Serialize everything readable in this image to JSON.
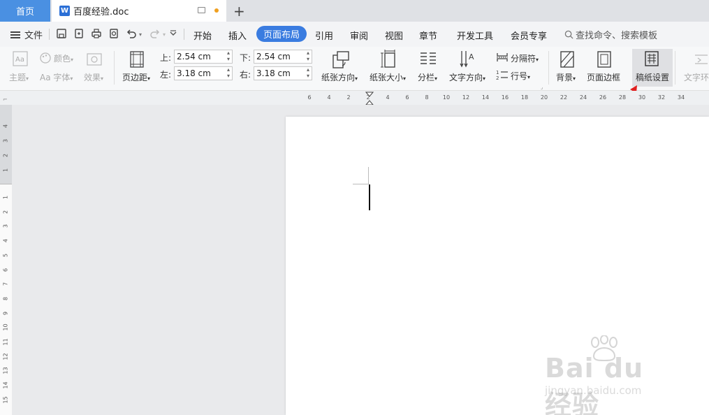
{
  "tabs": {
    "home": "首页",
    "doc_icon": "W",
    "doc_title": "百度经验.doc",
    "add": "+"
  },
  "menu": {
    "file": "文件",
    "tabs": [
      "开始",
      "插入",
      "页面布局",
      "引用",
      "审阅",
      "视图",
      "章节",
      "开发工具",
      "会员专享"
    ],
    "active_tab": "页面布局",
    "search": "查找命令、搜索模板"
  },
  "ribbon": {
    "theme": "主题",
    "color": "颜色",
    "font": "字体",
    "effect": "效果",
    "margins": "页边距",
    "top_label": "上:",
    "top_value": "2.54 cm",
    "bottom_label": "下:",
    "bottom_value": "2.54 cm",
    "left_label": "左:",
    "left_value": "3.18 cm",
    "right_label": "右:",
    "right_value": "3.18 cm",
    "orientation": "纸张方向",
    "size": "纸张大小",
    "columns": "分栏",
    "text_direction": "文字方向",
    "breaks": "分隔符",
    "line_numbers": "行号",
    "background": "背景",
    "page_border": "页面边框",
    "manuscript": "稿纸设置",
    "text_wrap": "文字环"
  },
  "ruler": {
    "h_ticks": [
      "6",
      "4",
      "2",
      "2",
      "4",
      "6",
      "8",
      "10",
      "12",
      "14",
      "16",
      "18",
      "20",
      "22",
      "24",
      "26",
      "28",
      "30",
      "32",
      "34"
    ],
    "v_ticks_top": [
      "4",
      "3",
      "2",
      "1"
    ],
    "v_ticks_bottom": [
      "1",
      "2",
      "3",
      "4",
      "5",
      "6",
      "7",
      "8",
      "9",
      "10",
      "11",
      "12",
      "13",
      "14",
      "15"
    ]
  },
  "watermark": {
    "logo": "Bai du 经验",
    "url": "jingyan.baidu.com"
  },
  "colors": {
    "accent": "#3a7ce0",
    "home_tab": "#4a90e2",
    "arrow": "#e02020"
  }
}
